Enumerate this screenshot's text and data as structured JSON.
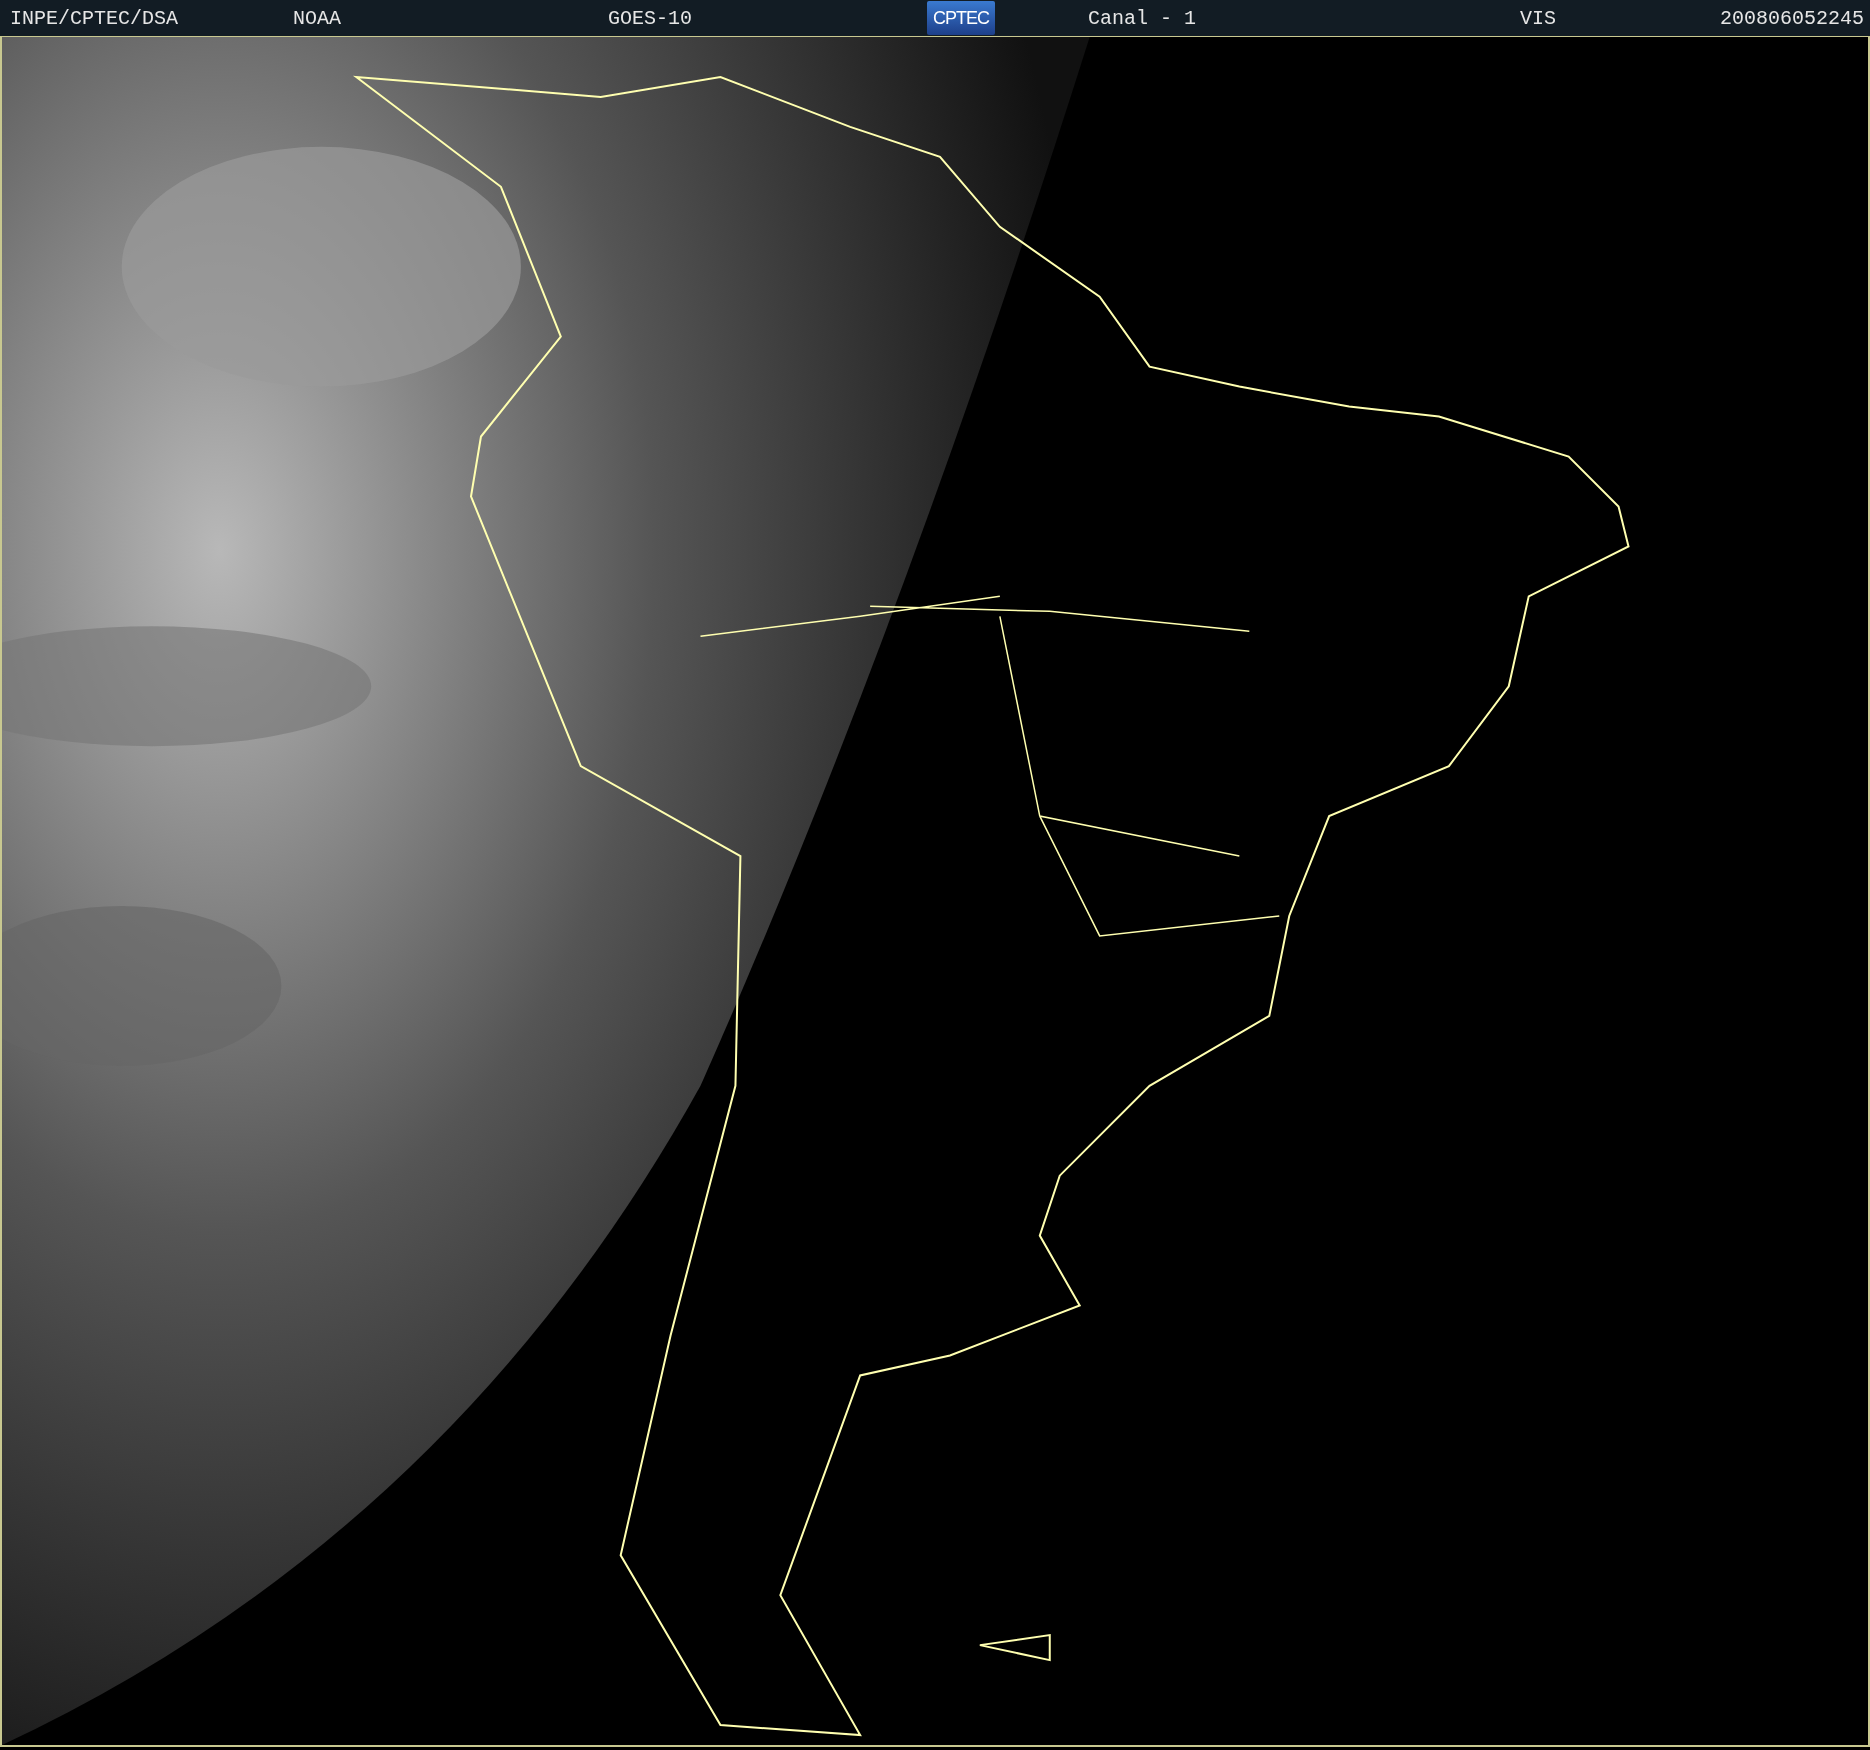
{
  "header": {
    "items": [
      {
        "kind": "text",
        "text": "INPE/CPTEC/DSA"
      },
      {
        "kind": "text",
        "text": "NOAA"
      },
      {
        "kind": "text",
        "text": "GOES-10"
      },
      {
        "kind": "logo",
        "text": "CPTEC"
      },
      {
        "kind": "text",
        "text": "Canal - 1"
      },
      {
        "kind": "text",
        "text": "VIS"
      },
      {
        "kind": "text",
        "text": "200806052245"
      }
    ]
  }
}
